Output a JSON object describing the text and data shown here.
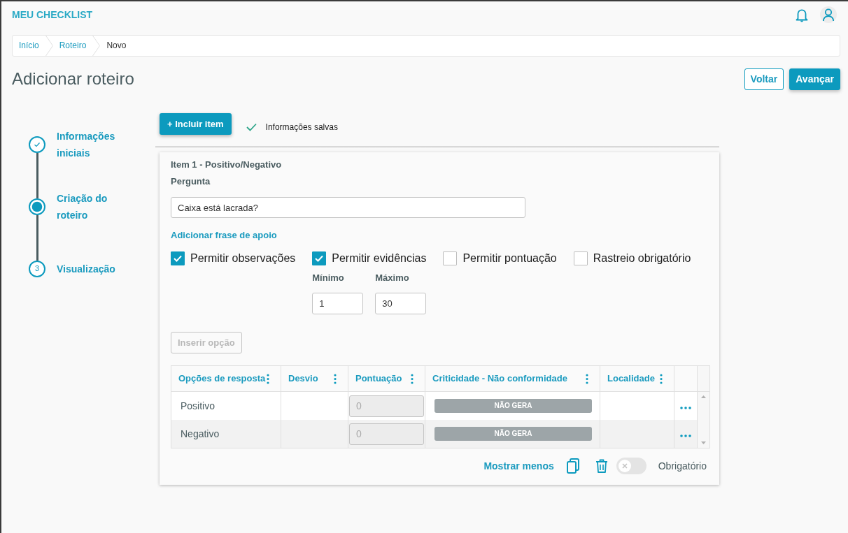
{
  "header": {
    "brand": "MEU CHECKLIST"
  },
  "breadcrumb": [
    {
      "label": "Início",
      "current": false
    },
    {
      "label": "Roteiro",
      "current": false
    },
    {
      "label": "Novo",
      "current": true
    }
  ],
  "page": {
    "title": "Adicionar roteiro",
    "actions": [
      {
        "label": "Voltar",
        "kind": "outline"
      },
      {
        "label": "Avançar",
        "kind": "primary"
      }
    ]
  },
  "steps": [
    {
      "label": "Informações iniciais",
      "completed": true,
      "selected": false
    },
    {
      "label": "Criação do roteiro",
      "completed": false,
      "selected": true
    },
    {
      "label": "Visualização",
      "number": "3",
      "completed": false,
      "selected": false
    }
  ],
  "toolbar": {
    "add_button": "+ Incluir item",
    "save_status": "Informações salvas"
  },
  "item": {
    "title": "Item 1 - Positivo/Negativo",
    "question_label": "Pergunta",
    "question": "Caixa está lacrada?",
    "support_link": "Adicionar frase de apoio",
    "options": [
      {
        "label": "Permitir observações",
        "checked": true
      },
      {
        "label": "Permitir evidências",
        "checked": true,
        "fields": [
          {
            "label": "Mínimo",
            "value": "1"
          },
          {
            "label": "Máximo",
            "value": "30"
          }
        ]
      },
      {
        "label": "Permitir pontuação",
        "checked": false
      },
      {
        "label": "Rastreio obrigatório",
        "checked": false
      }
    ],
    "insert_button": {
      "label": "Inserir opção",
      "disabled": true
    },
    "table": {
      "columns": [
        "Opções de resposta",
        "Desvio",
        "Pontuação",
        "Criticidade - Não conformidade",
        "Localidade"
      ],
      "rows": [
        {
          "answer": "Positivo",
          "score": {
            "value": "0",
            "disabled": true
          },
          "criticality": "NÃO GERA"
        },
        {
          "answer": "Negativo",
          "score": {
            "value": "0",
            "disabled": true
          },
          "criticality": "NÃO GERA"
        }
      ]
    },
    "footer": {
      "show_less": "Mostrar menos",
      "required_label": "Obrigatório",
      "required": false
    }
  }
}
